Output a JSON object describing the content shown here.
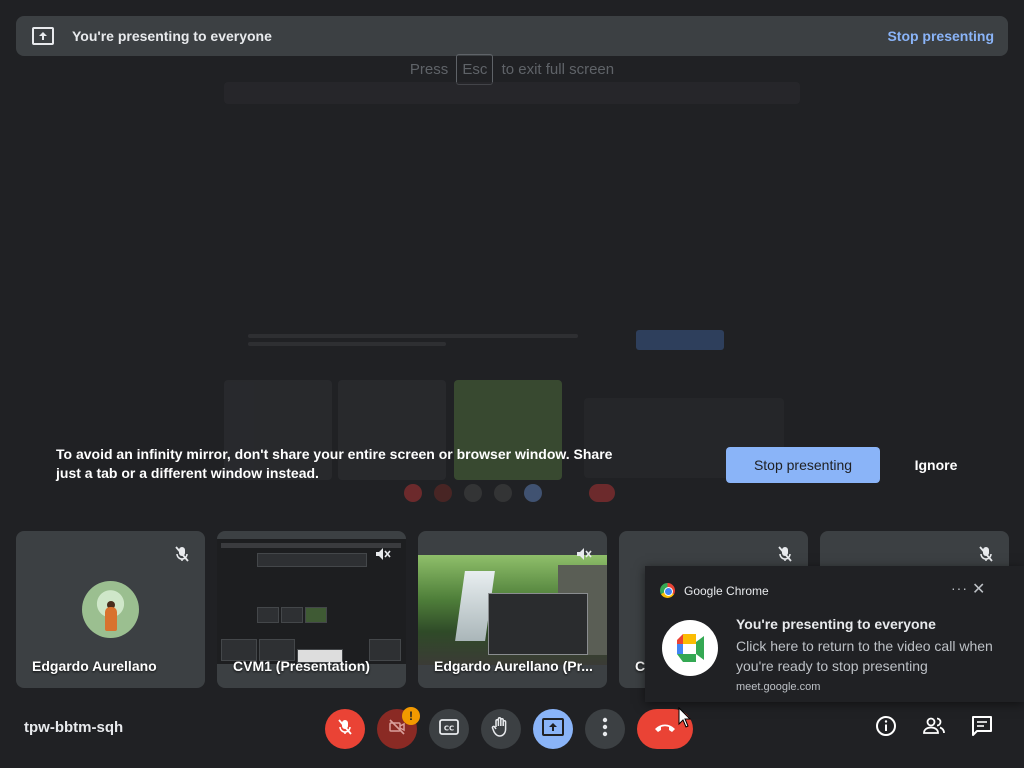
{
  "banner": {
    "title": "You're presenting to everyone",
    "stop_link": "Stop presenting"
  },
  "esc_hint": {
    "prefix": "Press",
    "key": "Esc",
    "suffix": "to exit full screen"
  },
  "infinity_warning": {
    "text": "To avoid an infinity mirror, don't share your entire screen or browser window. Share just a tab or a different window instead.",
    "stop_button": "Stop presenting",
    "ignore_button": "Ignore"
  },
  "tiles": [
    {
      "name": "Edgardo Aurellano",
      "muted": true,
      "type": "avatar"
    },
    {
      "name": "CVM1 (Presentation)",
      "muted": true,
      "type": "screen"
    },
    {
      "name": "Edgardo Aurellano (Pr...",
      "muted": true,
      "type": "nature"
    },
    {
      "name": "C",
      "muted": true,
      "type": "blank"
    },
    {
      "name": "",
      "muted": true,
      "type": "blank"
    }
  ],
  "notification": {
    "app": "Google Chrome",
    "title": "You're presenting to everyone",
    "body": "Click here to return to the video call when you're ready to stop presenting",
    "source": "meet.google.com"
  },
  "bottom_bar": {
    "meeting_code": "tpw-bbtm-sqh",
    "camera_badge": "!",
    "controls": [
      "mic-off",
      "camera-off",
      "captions",
      "raise-hand",
      "present",
      "more-options",
      "leave-call"
    ],
    "right_controls": [
      "meeting-details",
      "people",
      "chat"
    ]
  },
  "colors": {
    "background": "#202124",
    "accent": "#8ab4f8",
    "danger": "#ea4335",
    "warning": "#f29900"
  }
}
